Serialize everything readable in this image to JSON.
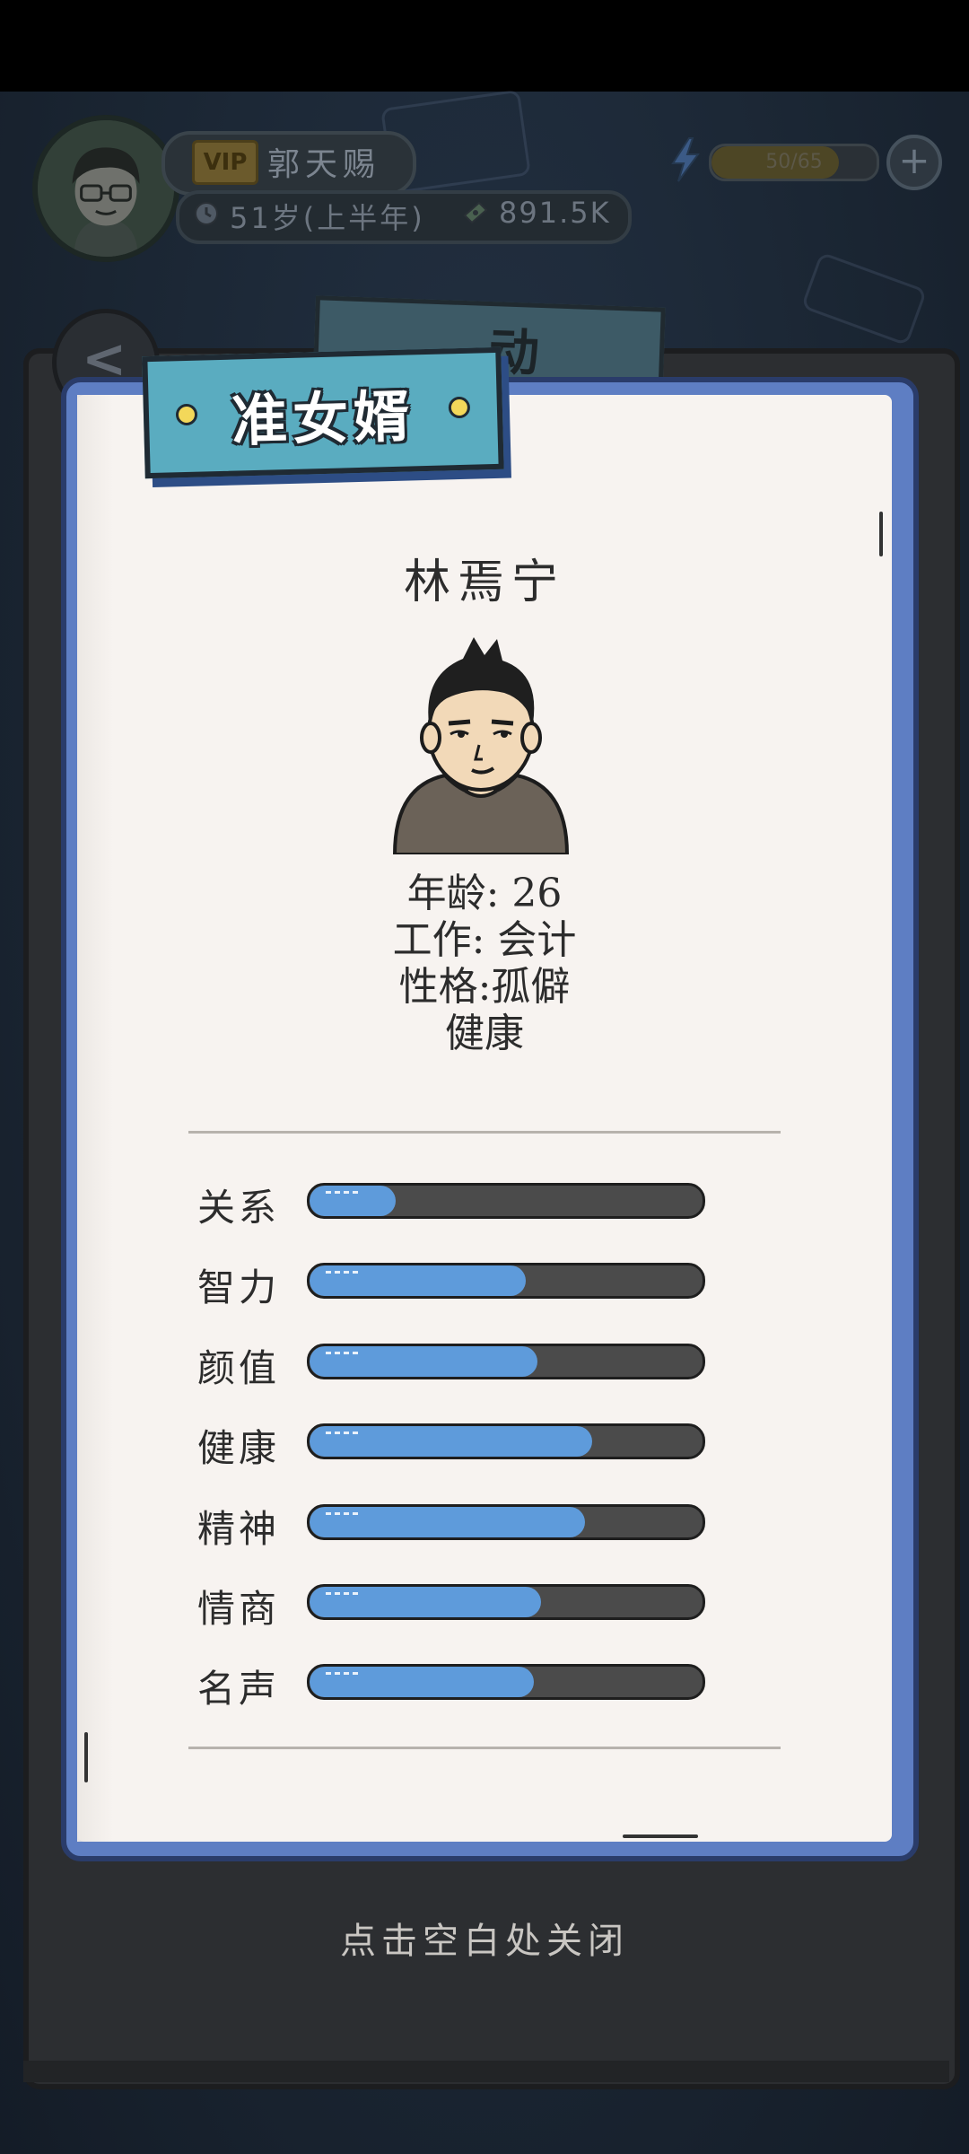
{
  "player": {
    "vip_label": "VIP",
    "name": "郭天赐",
    "age": "51岁(上半年)",
    "money": "891.5K",
    "energy": "50/65",
    "energy_fraction": 0.77,
    "plus_label": "+"
  },
  "background": {
    "tab_label": "动"
  },
  "card": {
    "title": "准女婿",
    "name": "林焉宁",
    "details": {
      "age": "年龄: 26",
      "job": "工作: 会计",
      "personality": "性格:孤僻",
      "health": "健康"
    },
    "stats": [
      {
        "label": "关系",
        "value": 0.22
      },
      {
        "label": "智力",
        "value": 0.55
      },
      {
        "label": "颜值",
        "value": 0.58
      },
      {
        "label": "健康",
        "value": 0.72
      },
      {
        "label": "精神",
        "value": 0.7
      },
      {
        "label": "情商",
        "value": 0.59
      },
      {
        "label": "名声",
        "value": 0.57
      }
    ]
  },
  "close_hint": "点击空白处关闭",
  "colors": {
    "stat_fill": "#5e9bdb",
    "stat_track": "#4b4b4b",
    "card_border": "#5e7ec3",
    "ribbon": "#5aacc0"
  }
}
